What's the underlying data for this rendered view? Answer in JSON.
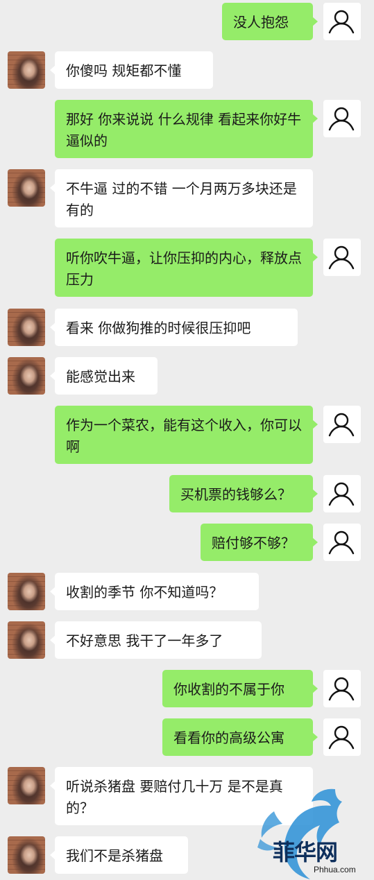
{
  "messages": [
    {
      "side": "me",
      "text": "没人抱怨"
    },
    {
      "side": "them",
      "text": "你傻吗  规矩都不懂"
    },
    {
      "side": "me",
      "text": "那好 你来说说 什么规律 看起来你好牛逼似的"
    },
    {
      "side": "them",
      "text": "不牛逼     过的不错   一个月两万多块还是有的"
    },
    {
      "side": "me",
      "text": "听你吹牛逼，让你压抑的内心，释放点压力"
    },
    {
      "side": "them",
      "text": "看来 你做狗推的时候很压抑吧"
    },
    {
      "side": "them",
      "text": "能感觉出来"
    },
    {
      "side": "me",
      "text": "作为一个菜农，能有这个收入，你可以啊"
    },
    {
      "side": "me",
      "text": "买机票的钱够么？"
    },
    {
      "side": "me",
      "text": "赔付够不够？"
    },
    {
      "side": "them",
      "text": "收割的季节   你不知道吗？"
    },
    {
      "side": "them",
      "text": "不好意思 我干了一年多了"
    },
    {
      "side": "me",
      "text": "你收割的不属于你"
    },
    {
      "side": "me",
      "text": "看看你的高级公寓"
    },
    {
      "side": "them",
      "text": "听说杀猪盘 要赔付几十万  是不是真的？"
    },
    {
      "side": "them",
      "text": "我们不是杀猪盘"
    }
  ],
  "watermark": {
    "main": "菲华网",
    "domain": "Phhua.com"
  },
  "colors": {
    "background": "#ededed",
    "bubble_me": "#95ec69",
    "bubble_them": "#ffffff",
    "watermark_dragon": "#2a8fd6"
  }
}
